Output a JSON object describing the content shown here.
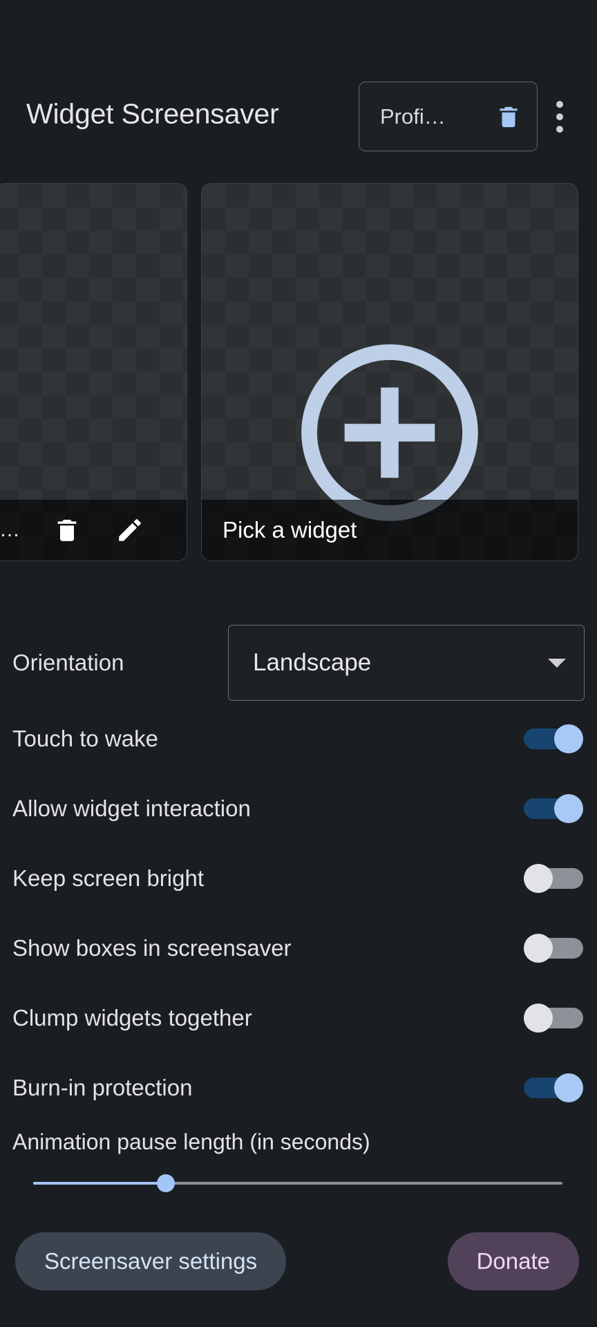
{
  "header": {
    "title": "Widget Screensaver",
    "profile_chip": {
      "label": "Profi…",
      "delete_icon": "trash-icon"
    },
    "overflow_icon": "more-vertical-icon"
  },
  "widgets": {
    "existing_card": {
      "truncated_label": "…",
      "delete_icon": "trash-icon",
      "edit_icon": "pencil-icon"
    },
    "pick_card": {
      "label": "Pick a widget",
      "add_icon": "plus-circle-icon"
    }
  },
  "settings": {
    "orientation": {
      "label": "Orientation",
      "value": "Landscape",
      "caret_icon": "chevron-down-icon"
    },
    "toggles": [
      {
        "label": "Touch to wake",
        "state": "on"
      },
      {
        "label": "Allow widget interaction",
        "state": "on"
      },
      {
        "label": "Keep screen bright",
        "state": "off"
      },
      {
        "label": "Show boxes in screensaver",
        "state": "off"
      },
      {
        "label": "Clump widgets together",
        "state": "off"
      },
      {
        "label": "Burn-in protection",
        "state": "on"
      }
    ],
    "slider": {
      "label": "Animation pause length (in seconds)",
      "percent": 25
    }
  },
  "bottom": {
    "settings_button": "Screensaver settings",
    "donate_button": "Donate"
  },
  "colors": {
    "background": "#1a1d21",
    "accent_blue": "#a4c6f6",
    "toggle_on_track": "#17456f",
    "toggle_off_track": "#8e9298",
    "donate_bg": "#51425a",
    "donate_text": "#efd9f5",
    "settings_btn_bg": "#3b444f",
    "settings_btn_text": "#d6e3f5"
  }
}
